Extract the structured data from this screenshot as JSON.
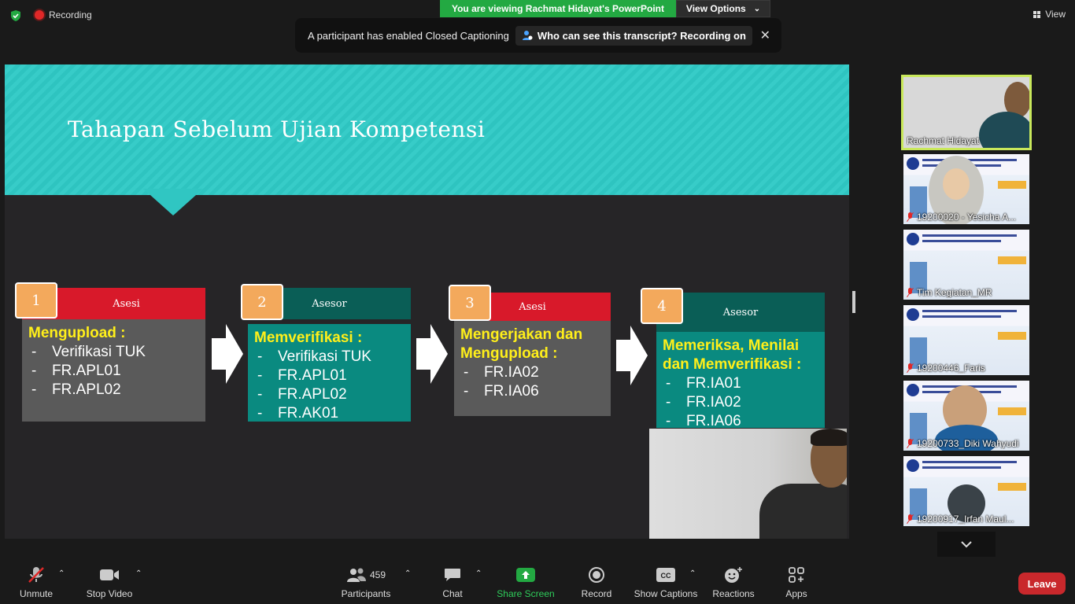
{
  "top": {
    "recording_label": "Recording",
    "viewing_banner": "You are viewing Rachmat Hidayat's PowerPoint",
    "view_options_label": "View Options",
    "view_label": "View"
  },
  "caption_notice": {
    "text": "A participant has enabled Closed Captioning",
    "link": "Who can see this transcript? Recording on",
    "close_glyph": "✕"
  },
  "slide": {
    "title": "Tahapan Sebelum Ujian Kompetensi",
    "steps": [
      {
        "number": "1",
        "role": "Asesi",
        "heading": "Mengupload :",
        "items": [
          "Verifikasi TUK",
          "FR.APL01",
          "FR.APL02"
        ]
      },
      {
        "number": "2",
        "role": "Asesor",
        "heading": "Memverifikasi :",
        "items": [
          "Verifikasi TUK",
          "FR.APL01",
          "FR.APL02",
          "FR.AK01"
        ]
      },
      {
        "number": "3",
        "role": "Asesi",
        "heading": "Mengerjakan dan Mengupload :",
        "items": [
          "FR.IA02",
          "FR.IA06"
        ]
      },
      {
        "number": "4",
        "role": "Asesor",
        "heading": "Memeriksa, Menilai dan Memverifikasi :",
        "items": [
          "FR.IA01",
          "FR.IA02",
          "FR.IA06"
        ]
      }
    ]
  },
  "participants_gallery": [
    {
      "name": "Rachmat Hidayat",
      "muted": false,
      "active": true
    },
    {
      "name": "19200020 - Yesicha A...",
      "muted": true
    },
    {
      "name": "Tim Kegiatan_MR",
      "muted": true
    },
    {
      "name": "19200446_Faris",
      "muted": true
    },
    {
      "name": "19200733_Diki Wahyudi",
      "muted": true
    },
    {
      "name": "19200917_Irfan Maul...",
      "muted": true
    }
  ],
  "toolbar": {
    "unmute": "Unmute",
    "stop_video": "Stop Video",
    "participants": "Participants",
    "participants_count": "459",
    "chat": "Chat",
    "share_screen": "Share Screen",
    "record": "Record",
    "show_captions": "Show Captions",
    "reactions": "Reactions",
    "apps": "Apps",
    "leave": "Leave"
  },
  "colors": {
    "share_green": "#23a942",
    "header_teal": "#2ec4c0",
    "asesi_red": "#d8192a",
    "asesor_teal": "#0a5e56",
    "badge_orange": "#f3a95c",
    "heading_yellow": "#ffef1a",
    "leave_red": "#c9282c",
    "active_speaker": "#c9e85b"
  },
  "icons": [
    "shield-icon",
    "record-icon",
    "caption-user-icon",
    "close-icon",
    "grid-view-icon",
    "mic-muted-icon",
    "video-icon",
    "participants-icon",
    "chat-icon",
    "share-screen-icon",
    "record-button-icon",
    "cc-icon",
    "reactions-icon",
    "apps-icon",
    "chevron-down-icon"
  ]
}
